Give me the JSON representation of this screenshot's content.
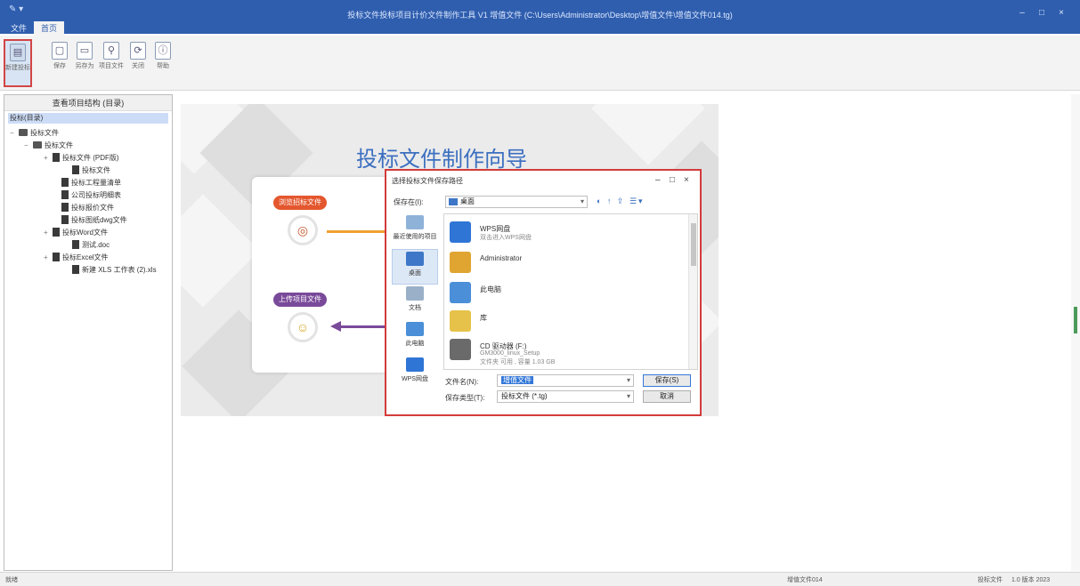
{
  "titlebar": {
    "app_icon": "✎ ▾",
    "title": "投标文件投标项目计价文件制作工具 V1 增值文件 (C:\\Users\\Administrator\\Desktop\\增值文件\\增值文件014.tg)",
    "minimize": "–",
    "maximize": "□",
    "close": "×"
  },
  "menu_tabs": [
    "文件",
    "首页"
  ],
  "ribbon": {
    "buttons": [
      {
        "label": "新建投标",
        "icon": "▤"
      },
      {
        "label": "保存",
        "icon": "▢"
      },
      {
        "label": "另存为",
        "icon": "▭"
      },
      {
        "label": "项目文件",
        "icon": "⚲"
      },
      {
        "label": "关闭",
        "icon": "⟳"
      },
      {
        "label": "帮助",
        "icon": "ⓘ"
      }
    ]
  },
  "sidebar": {
    "title": "查看项目结构 (目录)",
    "selected_root": "投标(目录)",
    "tree": [
      {
        "label": "投标文件",
        "level": 0,
        "type": "folder",
        "toggle": "−"
      },
      {
        "label": "投标文件",
        "level": 1,
        "type": "folder",
        "toggle": "−"
      },
      {
        "label": "投标文件 (PDF版)",
        "level": 2,
        "type": "file",
        "toggle": "+"
      },
      {
        "label": "投标文件",
        "level": 3,
        "type": "file",
        "toggle": ""
      },
      {
        "label": "投标工程量清单",
        "level": 2,
        "type": "file",
        "toggle": ""
      },
      {
        "label": "公司投标明细表",
        "level": 2,
        "type": "file",
        "toggle": ""
      },
      {
        "label": "投标报价文件",
        "level": 2,
        "type": "file",
        "toggle": ""
      },
      {
        "label": "投标图纸dwg文件",
        "level": 2,
        "type": "file",
        "toggle": ""
      },
      {
        "label": "投标Word文件",
        "level": 2,
        "type": "file",
        "toggle": "+"
      },
      {
        "label": "测试.doc",
        "level": 3,
        "type": "file",
        "toggle": ""
      },
      {
        "label": "投标Excel文件",
        "level": 2,
        "type": "file",
        "toggle": "+"
      },
      {
        "label": "新建 XLS 工作表 (2).xls",
        "level": 3,
        "type": "file",
        "toggle": ""
      }
    ]
  },
  "wizard": {
    "title": "投标文件制作向导",
    "step1_label": "浏览招标文件",
    "step2_label": "上传项目文件",
    "step1_icon": "◎",
    "step2_icon": "☺"
  },
  "dialog": {
    "title": "选择投标文件保存路径",
    "minimize": "–",
    "maximize": "□",
    "close": "×",
    "look_in_label": "保存在(I):",
    "look_in_value": "桌面",
    "tools": "◐ ↑ ⇪ ☰▾",
    "places": [
      {
        "label": "最近使用的项目",
        "color": "#8fb2d9"
      },
      {
        "label": "桌面",
        "color": "#3e77c7",
        "selected": true
      },
      {
        "label": "文档",
        "color": "#9ab0c8"
      },
      {
        "label": "此电脑",
        "color": "#4a8fd8"
      },
      {
        "label": "WPS网盘",
        "color": "#2f75d6"
      }
    ],
    "files": [
      {
        "name": "WPS网盘",
        "sub": "双击进入WPS网盘",
        "sub2": "",
        "color": "#2f75d6"
      },
      {
        "name": "Administrator",
        "sub": "",
        "sub2": "",
        "color": "#e0a531"
      },
      {
        "name": "此电脑",
        "sub": "",
        "sub2": "",
        "color": "#4a8fd8"
      },
      {
        "name": "库",
        "sub": "",
        "sub2": "",
        "color": "#e6c24a"
      },
      {
        "name": "CD 驱动器 (F:)",
        "sub": "GM3000_linux_Setup",
        "sub2": "文件夹 可用 , 容量 1.03 GB",
        "color": "#6a6a6a"
      }
    ],
    "file_name_label": "文件名(N):",
    "file_name_value": "增值文件",
    "file_type_label": "保存类型(T):",
    "file_type_value": "投标文件 (*.tg)",
    "save_button": "保存(S)",
    "cancel_button": "取消"
  },
  "statusbar": {
    "left": "就绪",
    "middle": "增值文件014",
    "right1": "投标文件",
    "right2": "1.0  版本  2023"
  }
}
